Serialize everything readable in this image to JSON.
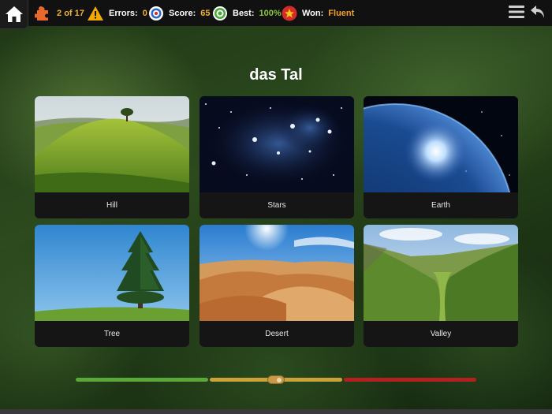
{
  "header": {
    "progress": {
      "current": "2",
      "of_label": "of",
      "total": "17"
    },
    "errors": {
      "label": "Errors:",
      "value": "0"
    },
    "score": {
      "label": "Score:",
      "value": "65"
    },
    "best": {
      "label": "Best:",
      "value": "100%"
    },
    "won": {
      "label": "Won:",
      "value": "Fluent"
    },
    "icons": [
      "home-icon",
      "puzzle-icon",
      "warning-icon",
      "target-icon",
      "bullseye-icon",
      "star-badge-icon",
      "menu-icon",
      "back-arrow-icon"
    ]
  },
  "question": {
    "word": "das Tal"
  },
  "choices": [
    {
      "label": "Hill"
    },
    {
      "label": "Stars"
    },
    {
      "label": "Earth"
    },
    {
      "label": "Tree"
    },
    {
      "label": "Desert"
    },
    {
      "label": "Valley"
    }
  ],
  "slider": {
    "value": 0.5,
    "colors": {
      "left": "#5aa83a",
      "middle": "#c9a23a",
      "right": "#b32020"
    }
  },
  "colors": {
    "accent": "#f2b233",
    "best": "#8cc63f",
    "topbar": "#111111"
  }
}
